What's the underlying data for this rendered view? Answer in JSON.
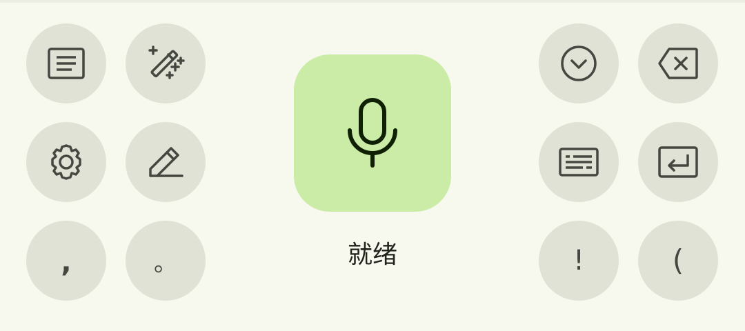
{
  "status": {
    "label": "就绪"
  },
  "punctuation": {
    "comma": ",",
    "period": "。",
    "exclamation": "!",
    "open_paren": "("
  },
  "icons": {
    "clipboard": "text-lines-icon",
    "magic": "magic-wand-icon",
    "settings": "gear-icon",
    "edit": "pencil-icon",
    "hide": "chevron-down-circle-icon",
    "delete": "backspace-icon",
    "keyboard": "keyboard-icon",
    "enter": "enter-icon",
    "mic": "microphone-icon"
  },
  "colors": {
    "background": "#f7f8ee",
    "button": "#e1e2d6",
    "mic_button": "#cbeca6",
    "icon": "#454840",
    "mic_icon": "#0f2005"
  }
}
